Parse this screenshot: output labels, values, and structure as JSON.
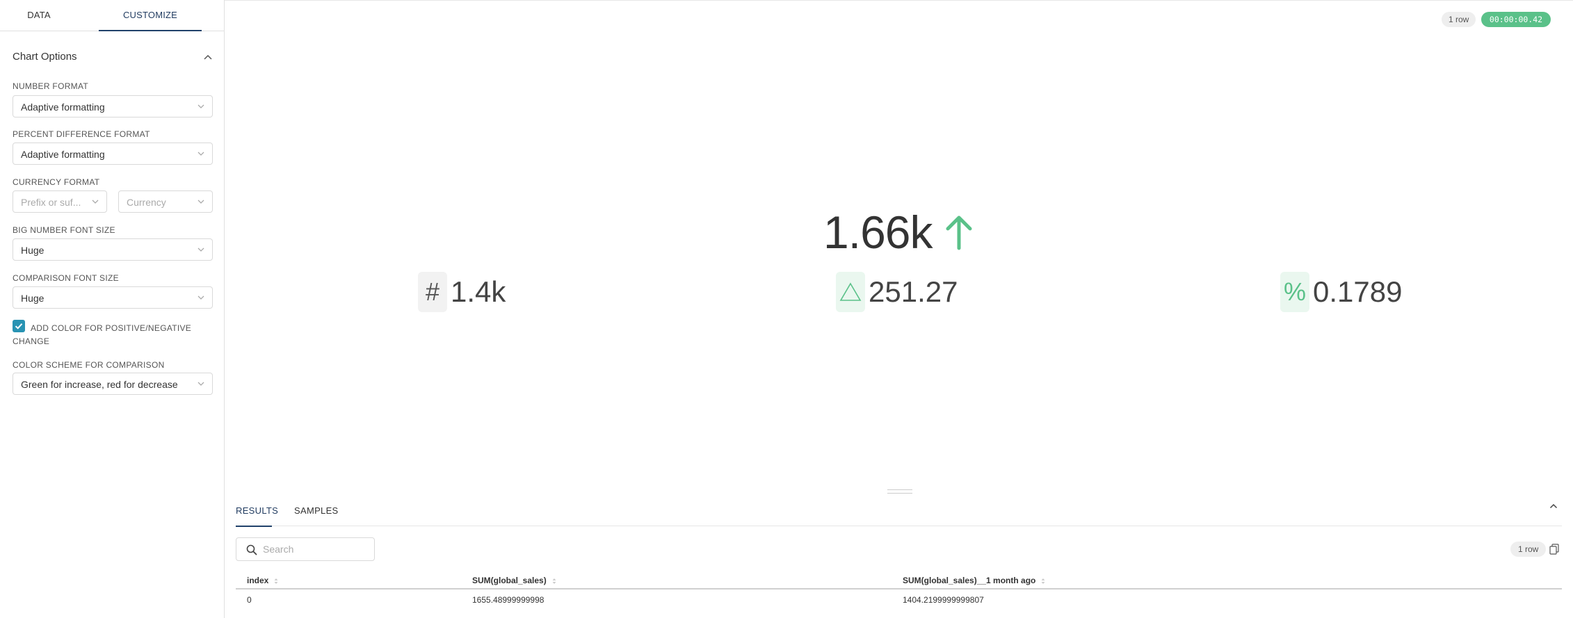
{
  "tabs": {
    "data": "DATA",
    "customize": "CUSTOMIZE"
  },
  "chart_options": {
    "title": "Chart Options",
    "number_format": {
      "label": "NUMBER FORMAT",
      "value": "Adaptive formatting"
    },
    "percent_difference_format": {
      "label": "PERCENT DIFFERENCE FORMAT",
      "value": "Adaptive formatting"
    },
    "currency_format": {
      "label": "CURRENCY FORMAT",
      "prefix_placeholder": "Prefix or suf...",
      "currency_placeholder": "Currency"
    },
    "big_number_font_size": {
      "label": "BIG NUMBER FONT SIZE",
      "value": "Huge"
    },
    "comparison_font_size": {
      "label": "COMPARISON FONT SIZE",
      "value": "Huge"
    },
    "color_checkbox": {
      "label": "ADD COLOR FOR POSITIVE/NEGATIVE CHANGE",
      "checked": true
    },
    "color_scheme": {
      "label": "COLOR SCHEME FOR COMPARISON",
      "value": "Green for increase, red for decrease"
    }
  },
  "header": {
    "rows_badge": "1 row",
    "timer": "00:00:00.42"
  },
  "big_number": {
    "value": "1.66k",
    "trend": "up",
    "color": "#5ac189",
    "comparisons": [
      {
        "icon": "#",
        "value": "1.4k"
      },
      {
        "icon": "△",
        "value": "251.27"
      },
      {
        "icon": "%",
        "value": "0.1789"
      }
    ]
  },
  "results": {
    "tabs": [
      "RESULTS",
      "SAMPLES"
    ],
    "search_placeholder": "Search",
    "rows_badge": "1 row",
    "columns": [
      "index",
      "SUM(global_sales)",
      "SUM(global_sales)__1 month ago"
    ],
    "rows": [
      [
        "0",
        "1655.48999999998",
        "1404.2199999999807"
      ]
    ]
  },
  "colors": {
    "accent": "#20416a",
    "positive": "#5ac189",
    "checkbox": "#2893b3"
  }
}
